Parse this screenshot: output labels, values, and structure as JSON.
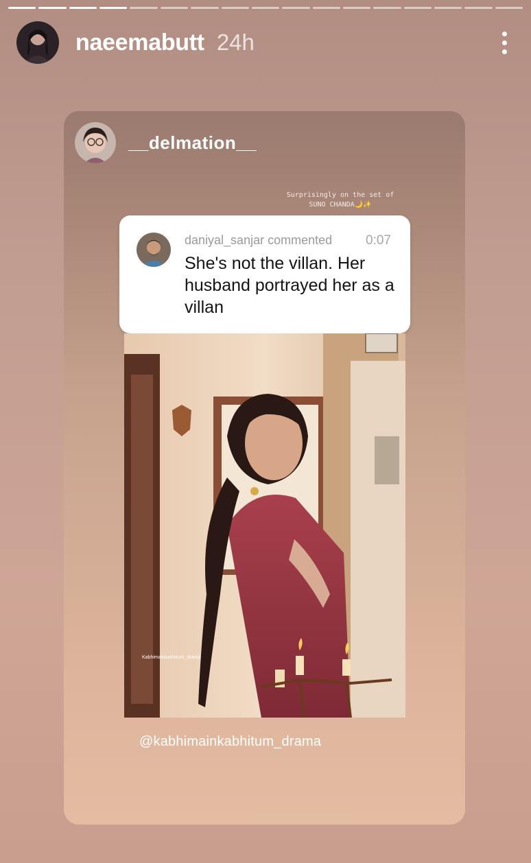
{
  "story": {
    "username": "naeemabutt",
    "time": "24h",
    "progress_segments": 17,
    "progress_completed": 4
  },
  "shared_post": {
    "username": "__delmation__",
    "caption": "Surprisingly on the set of SUNO CHANDA🌙✨",
    "comment": {
      "author_line": "daniyal_sanjar commented",
      "duration": "0:07",
      "text": "She's not the villan. Her husband portrayed her as a villan"
    },
    "video_watermark": "Kabhimainkabhitum_drama",
    "mention": "@kabhimainkabhitum_drama"
  },
  "icons": {
    "more": "more-vertical-icon"
  }
}
